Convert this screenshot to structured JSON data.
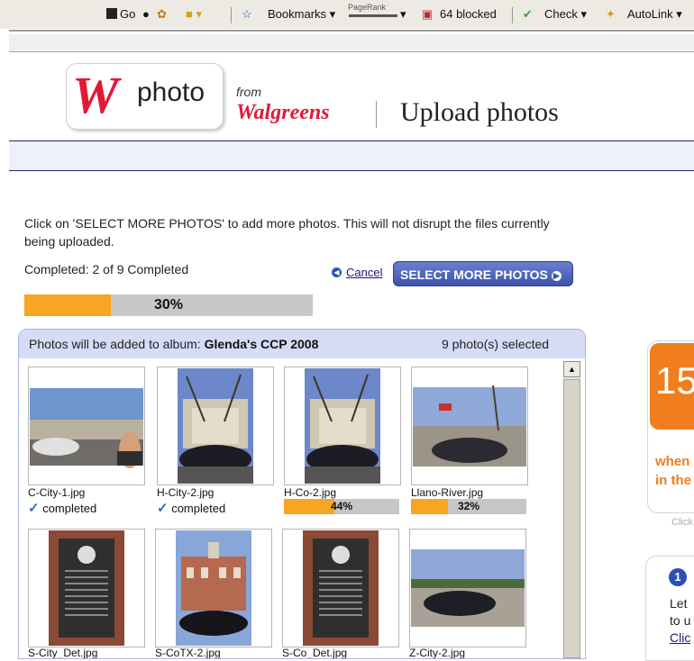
{
  "toolbar": {
    "go": "Go",
    "bookmarks": "Bookmarks",
    "pagerank": "PageRank",
    "blocked": "64 blocked",
    "check": "Check",
    "autolink": "AutoLink"
  },
  "header": {
    "logo_mark": "W",
    "logo_word": "photo",
    "from": "from",
    "brand": "Walgreens",
    "title": "Upload photos"
  },
  "upload": {
    "instructions": "Click on 'SELECT MORE PHOTOS' to add more photos. This will not disrupt the files currently being uploaded.",
    "completed": "Completed: 2 of 9 Completed",
    "cancel_label": "Cancel",
    "select_more_label": "SELECT MORE PHOTOS",
    "progress_label": "30%",
    "progress_fraction": 0.3
  },
  "album": {
    "prefix": "Photos will be added to album:",
    "name": "Glenda's CCP 2008",
    "count": "9 photo(s) selected",
    "photos": [
      {
        "file": "C-City-1.jpg",
        "status": "completed"
      },
      {
        "file": "H-City-2.jpg",
        "status": "completed"
      },
      {
        "file": "H-Co-2.jpg",
        "progress": "44%",
        "fraction": 0.44
      },
      {
        "file": "Llano-River.jpg",
        "progress": "32%",
        "fraction": 0.32
      },
      {
        "file": "S-City_Det.jpg"
      },
      {
        "file": "S-CoTX-2.jpg"
      },
      {
        "file": "S-Co_Det.jpg"
      },
      {
        "file": "Z-City-2.jpg"
      }
    ]
  },
  "promo": {
    "number": "15",
    "line1": "when",
    "line2": "in the",
    "click": "Click"
  },
  "info": {
    "icon": "1",
    "line1": "Let",
    "line2": "to u",
    "line3": "Clic"
  },
  "colors": {
    "progress": "#f6a623",
    "brand_red": "#e31837",
    "button_blue": "#3d52ae",
    "panel_header": "#d6dbf6"
  }
}
